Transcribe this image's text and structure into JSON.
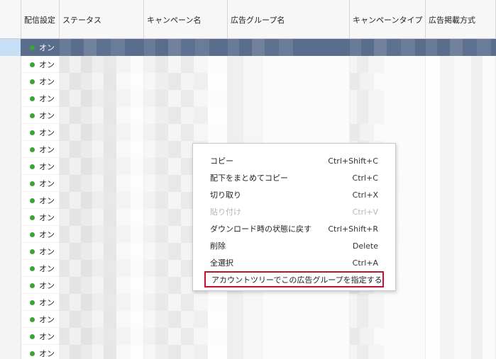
{
  "columns": [
    "配信設定",
    "ステータス",
    "キャンペーン名",
    "広告グループ名",
    "キャンペーンタイプ",
    "広告掲載方式"
  ],
  "status_value": "オン",
  "status_color": "#3aa335",
  "selected_row_color": "#5a6d8c",
  "row_count": 19,
  "context_menu": {
    "items": [
      {
        "label": "コピー",
        "shortcut": "Ctrl+Shift+C"
      },
      {
        "label": "配下をまとめてコピー",
        "shortcut": "Ctrl+C"
      },
      {
        "label": "切り取り",
        "shortcut": "Ctrl+X"
      },
      {
        "label": "貼り付け",
        "shortcut": "Ctrl+V"
      },
      {
        "label": "ダウンロード時の状態に戻す",
        "shortcut": "Ctrl+Shift+R"
      },
      {
        "label": "削除",
        "shortcut": "Delete"
      },
      {
        "label": "全選択",
        "shortcut": "Ctrl+A"
      },
      {
        "label": "アカウントツリーでこの広告グループを指定する",
        "shortcut": ""
      }
    ]
  }
}
